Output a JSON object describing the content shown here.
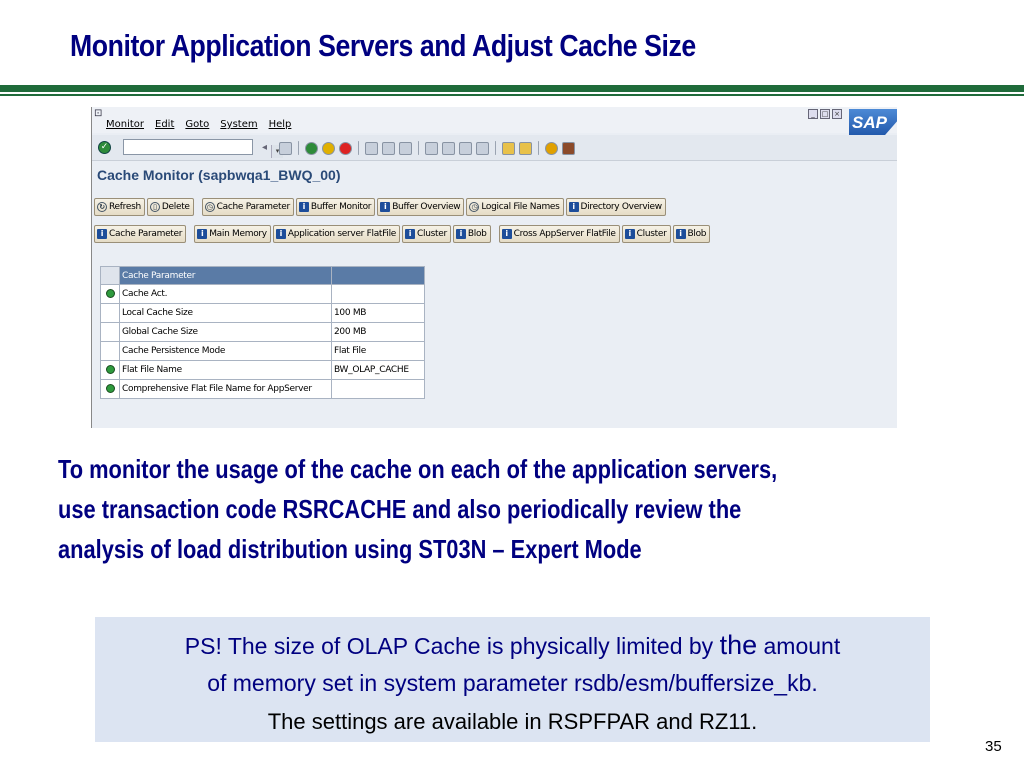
{
  "slide": {
    "title": "Monitor Application Servers and Adjust Cache Size",
    "page_number": "35"
  },
  "sap": {
    "menu": [
      "Monitor",
      "Edit",
      "Goto",
      "System",
      "Help"
    ],
    "logo_text": "SAP",
    "command_field": "",
    "screen_title": "Cache Monitor (sapbwqa1_BWQ_00)",
    "toolbar_row1": [
      {
        "label": "Refresh",
        "icon": "refresh-icon"
      },
      {
        "label": "Delete",
        "icon": "trash-icon"
      },
      {
        "label": "Cache Parameter",
        "icon": "clock-icon"
      },
      {
        "label": "Buffer Monitor",
        "icon": "info-icon"
      },
      {
        "label": "Buffer Overview",
        "icon": "info-icon"
      },
      {
        "label": "Logical File Names",
        "icon": "clock-icon"
      },
      {
        "label": "Directory Overview",
        "icon": "info-icon"
      }
    ],
    "toolbar_row2": [
      {
        "label": "Cache Parameter",
        "icon": "info-icon"
      },
      {
        "label": "Main Memory",
        "icon": "info-icon"
      },
      {
        "label": "Application server FlatFile",
        "icon": "info-icon"
      },
      {
        "label": "Cluster",
        "icon": "info-icon"
      },
      {
        "label": "Blob",
        "icon": "info-icon"
      },
      {
        "label": "Cross AppServer FlatFile",
        "icon": "info-icon"
      },
      {
        "label": "Cluster",
        "icon": "info-icon"
      },
      {
        "label": "Blob",
        "icon": "info-icon"
      }
    ],
    "table": {
      "header": "Cache Parameter",
      "rows": [
        {
          "status": "green",
          "name": "Cache Act.",
          "value": ""
        },
        {
          "status": "",
          "name": "Local Cache Size",
          "value": "100 MB"
        },
        {
          "status": "",
          "name": "Global Cache Size",
          "value": "200 MB"
        },
        {
          "status": "",
          "name": "Cache Persistence Mode",
          "value": "Flat File"
        },
        {
          "status": "green",
          "name": "Flat File Name",
          "value": "BW_OLAP_CACHE"
        },
        {
          "status": "green",
          "name": "Comprehensive Flat File Name for AppServer",
          "value": ""
        }
      ]
    }
  },
  "body": {
    "lines": [
      "To monitor the usage of the cache on each of the application servers,",
      "use transaction code RSRCACHE and also periodically review the",
      "analysis of load distribution using ST03N – Expert Mode"
    ]
  },
  "ps": {
    "line1_a": "PS! The size of OLAP Cache is physically limited by ",
    "line1_big": "the",
    "line1_b": " amount",
    "line2": "of memory set in system parameter rsdb/esm/buffersize_kb.",
    "line3": "The settings are available in RSPFPAR and RZ11."
  },
  "colors": {
    "title": "#000080",
    "rule": "#1f6b3a",
    "ps_background": "#dce4f2",
    "table_header": "#5a7ba6"
  }
}
